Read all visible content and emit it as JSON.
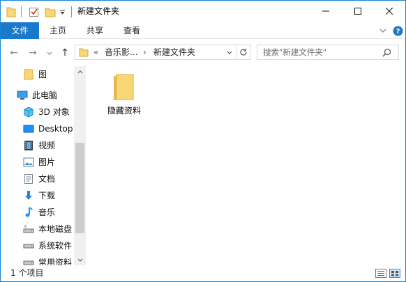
{
  "window": {
    "title": "新建文件夹",
    "controls": {
      "minimize": "—",
      "maximize": "☐",
      "close": "✕"
    }
  },
  "ribbon": {
    "tabs": [
      {
        "label": "文件"
      },
      {
        "label": "主页"
      },
      {
        "label": "共享"
      },
      {
        "label": "查看"
      }
    ],
    "expand_icon": "chevron-down-icon",
    "help_icon": "help-icon",
    "help_glyph": "?"
  },
  "address": {
    "back_glyph": "←",
    "forward_glyph": "→",
    "recent_glyph": "⌄",
    "up_glyph": "↑",
    "overflow": "«",
    "segments": [
      "音乐影...",
      "新建文件夹"
    ],
    "separator": "›",
    "dropdown_glyph": "⌄",
    "refresh_glyph": "↻"
  },
  "search": {
    "placeholder": "搜索\"新建文件夹\""
  },
  "nav": {
    "items": [
      {
        "label": "图",
        "icon": "folder-icon"
      },
      {
        "label": "此电脑",
        "icon": "computer-icon"
      },
      {
        "label": "3D 对象",
        "icon": "3d-objects-icon"
      },
      {
        "label": "Desktop",
        "icon": "desktop-icon"
      },
      {
        "label": "视频",
        "icon": "videos-icon"
      },
      {
        "label": "图片",
        "icon": "pictures-icon"
      },
      {
        "label": "文档",
        "icon": "documents-icon"
      },
      {
        "label": "下载",
        "icon": "downloads-icon"
      },
      {
        "label": "音乐",
        "icon": "music-icon"
      },
      {
        "label": "本地磁盘",
        "icon": "drive-icon"
      },
      {
        "label": "系统软件",
        "icon": "drive-icon"
      },
      {
        "label": "常用资料",
        "icon": "drive-icon"
      }
    ]
  },
  "content": {
    "items": [
      {
        "name": "隐藏资料",
        "icon": "folder-icon"
      }
    ]
  },
  "status": {
    "count_text": "1 个项目"
  },
  "colors": {
    "accent": "#1979ca",
    "folder": "#f8d775",
    "folder_dark": "#e6b94f",
    "border": "#1883d7"
  }
}
